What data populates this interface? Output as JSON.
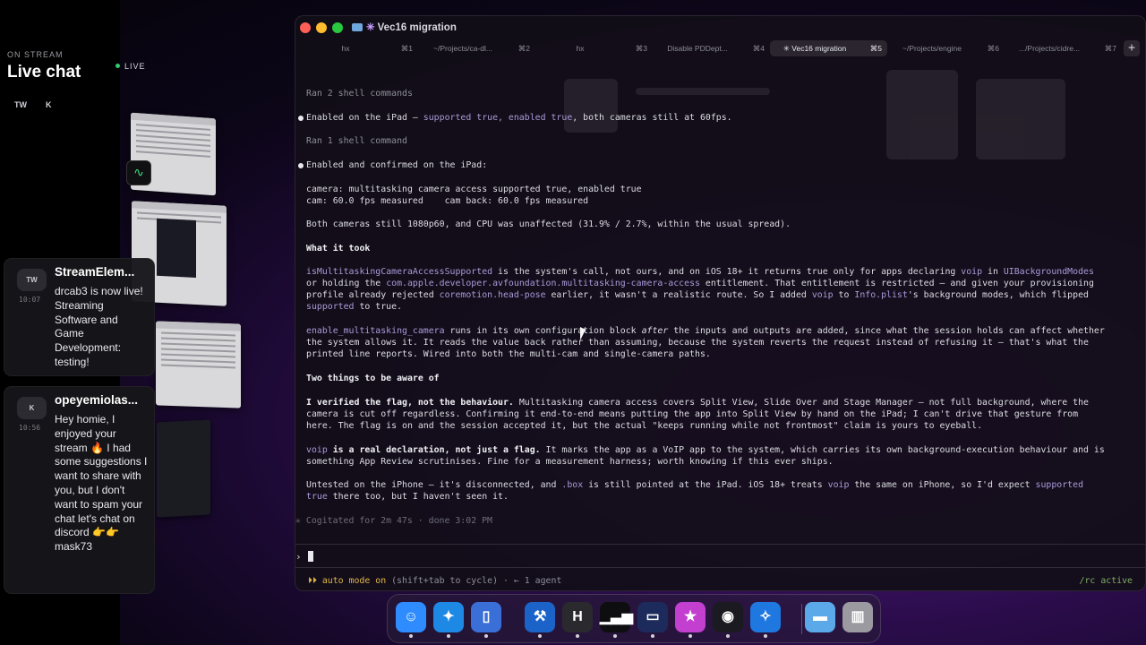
{
  "chat": {
    "overline": "ON STREAM",
    "title": "Live chat",
    "live_label": "LIVE",
    "filters": [
      "TW",
      "K"
    ],
    "messages": [
      {
        "badge": "TW",
        "time": "10:07",
        "user": "StreamElem...",
        "text": "drcab3 is now live! Streaming Software and Game Development: testing!"
      },
      {
        "badge": "K",
        "time": "10:56",
        "user": "opeyemiolas...",
        "text": "Hey homie, I enjoyed your stream 🔥 I had some suggestions I want to share with you, but I don't want to spam your chat let's chat on discord 👉👉 mask73"
      }
    ]
  },
  "terminal": {
    "title": "Vec16 migration",
    "tabs": [
      {
        "name": "hx",
        "key": "⌘1"
      },
      {
        "name": "~/Projects/ca-dl...",
        "key": "⌘2"
      },
      {
        "name": "hx",
        "key": "⌘3"
      },
      {
        "name": "Disable PDDept...",
        "key": "⌘4"
      },
      {
        "name": "✳ Vec16 migration",
        "key": "⌘5"
      },
      {
        "name": "~/Projects/engine",
        "key": "⌘6"
      },
      {
        "name": ".../Projects/cidre...",
        "key": "⌘7"
      }
    ],
    "add_tab": "+",
    "lines": {
      "l1": "Ran 2 shell commands",
      "l2a": "Enabled on the iPad — ",
      "l2b": "supported true, enabled true",
      "l2c": ", both cameras still at 60fps.",
      "l3": "Ran 1 shell command",
      "l4": "Enabled and confirmed on the iPad:",
      "l5": "camera: multitasking camera access supported true, enabled true",
      "l6": "cam: 60.0 fps measured    cam back: 60.0 fps measured",
      "l7": "Both cameras still 1080p60, and CPU was unaffected (31.9% / 2.7%, within the usual spread).",
      "h1": "What it took",
      "p1a1": "isMultitaskingCameraAccessSupported",
      "p1a2": " is the system's call, not ours, and on iOS 18+ it returns true only for apps declaring ",
      "p1a3": "voip",
      "p1a4": " in ",
      "p1a5": "UIBackgroundModes",
      "p1b1": "or holding the ",
      "p1b2": "com.apple.developer.avfoundation.multitasking-camera-access",
      "p1b3": " entitlement. That entitlement is restricted — and given your provisioning",
      "p1c1": "profile already rejected ",
      "p1c2": "coremotion.head-pose",
      "p1c3": " earlier, it wasn't a realistic route. So I added ",
      "p1c4": "voip",
      "p1c5": " to ",
      "p1c6": "Info.plist",
      "p1c7": "'s background modes, which flipped",
      "p1d1": "supported",
      "p1d2": " to true.",
      "p2a1": "enable_multitasking_camera",
      "p2a2": " runs in its own configuration block ",
      "p2a3": "after",
      "p2a4": " the inputs and outputs are added, since what the session holds can affect whether",
      "p2b": "the system allows it. It reads the value back rather than assuming, because the system reverts the request instead of refusing it — that's what the",
      "p2c": "printed line reports. Wired into both the multi-cam and single-camera paths.",
      "h2": "Two things to be aware of",
      "p3a1": "I verified the flag, not the behaviour.",
      "p3a2": " Multitasking camera access covers Split View, Slide Over and Stage Manager — not full background, where the",
      "p3b": "camera is cut off regardless. Confirming it end-to-end means putting the app into Split View by hand on the iPad; I can't drive that gesture from",
      "p3c": "here. The flag is on and the session accepted it, but the actual \"keeps running while not frontmost\" claim is yours to eyeball.",
      "p4a1": "voip",
      "p4a2": " is a real declaration, not just a flag.",
      "p4a3": " It marks the app as a VoIP app to the system, which carries its own background-execution behaviour and is",
      "p4b": "something App Review scrutinises. Fine for a measurement harness; worth knowing if this ever ships.",
      "p5a1": "Untested on the iPhone — it's disconnected, and ",
      "p5a2": ".box",
      "p5a3": " is still pointed at the iPad. iOS 18+ treats ",
      "p5a4": "voip",
      "p5a5": " the same on iPhone, so I'd expect ",
      "p5a6": "supported",
      "p5b1": "true",
      "p5b2": " there too, but I haven't seen it.",
      "cog": "✳ Cogitated for 2m 47s · done 3:02 PM"
    },
    "prompt_symbol": "›",
    "status_mode": "⏵⏵ auto mode on",
    "status_rest": " (shift+tab to cycle) · ← 1 agent",
    "status_right": "/rc active"
  },
  "dock": {
    "apps": [
      {
        "name": "finder-app",
        "glyph": "☺",
        "bg": "#2f8cff"
      },
      {
        "name": "safari-app",
        "glyph": "✦",
        "bg": "#1e88e5"
      },
      {
        "name": "simulator-app",
        "glyph": "▯",
        "bg": "#3b6fd8"
      },
      {
        "name": "xcode-app",
        "glyph": "⚒",
        "bg": "#1b63c8"
      },
      {
        "name": "helix-app",
        "glyph": "H",
        "bg": "#2a2a2e"
      },
      {
        "name": "activity-monitor-app",
        "glyph": "▁▃▅",
        "bg": "#0e0e10"
      },
      {
        "name": "terminal-app",
        "glyph": "▭",
        "bg": "#1c2a5c"
      },
      {
        "name": "instruments-app",
        "glyph": "★",
        "bg": "#c23fcf"
      },
      {
        "name": "instruments-beta-app",
        "glyph": "◉",
        "bg": "#1a1a20"
      },
      {
        "name": "safari-beta-app",
        "glyph": "✧",
        "bg": "#1f77e0"
      },
      {
        "name": "downloads-folder",
        "glyph": "▬",
        "bg": "#5ba9e8"
      },
      {
        "name": "trash",
        "glyph": "▥",
        "bg": "#9a9aa0"
      }
    ]
  }
}
